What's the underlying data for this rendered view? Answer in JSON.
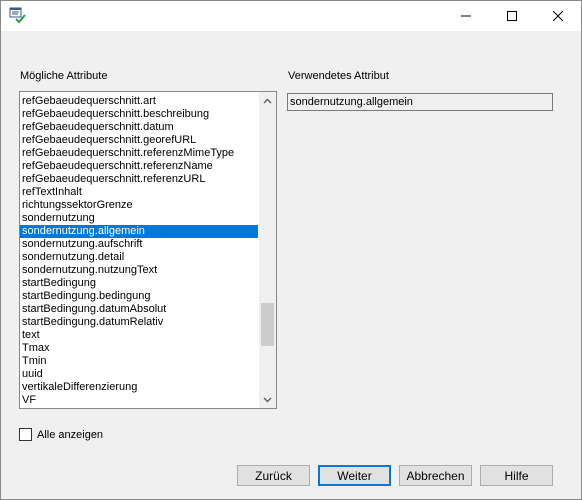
{
  "titlebar": {
    "app_icon": "dialog-checkmark-icon",
    "minimize_icon": "minimize-icon",
    "maximize_icon": "maximize-icon",
    "close_icon": "close-icon"
  },
  "left_panel": {
    "label": "Mögliche Attribute",
    "items": [
      "refGebaeudequerschnitt.art",
      "refGebaeudequerschnitt.beschreibung",
      "refGebaeudequerschnitt.datum",
      "refGebaeudequerschnitt.georefURL",
      "refGebaeudequerschnitt.referenzMimeType",
      "refGebaeudequerschnitt.referenzName",
      "refGebaeudequerschnitt.referenzURL",
      "refTextInhalt",
      "richtungssektorGrenze",
      "sondernutzung",
      "sondernutzung.allgemein",
      "sondernutzung.aufschrift",
      "sondernutzung.detail",
      "sondernutzung.nutzungText",
      "startBedingung",
      "startBedingung.bedingung",
      "startBedingung.datumAbsolut",
      "startBedingung.datumRelativ",
      "text",
      "Tmax",
      "Tmin",
      "uuid",
      "vertikaleDifferenzierung",
      "VF"
    ],
    "selected_index": 10,
    "scroll_position": 0.62
  },
  "right_panel": {
    "label": "Verwendetes Attribut",
    "value": "sondernutzung.allgemein"
  },
  "show_all": {
    "label": "Alle anzeigen",
    "checked": false
  },
  "buttons": {
    "back": "Zurück",
    "next": "Weiter",
    "cancel": "Abbrechen",
    "help": "Hilfe"
  },
  "colors": {
    "selection": "#0078d7",
    "default_button_border": "#0078d7",
    "checkmark": "#2e9e3e"
  }
}
